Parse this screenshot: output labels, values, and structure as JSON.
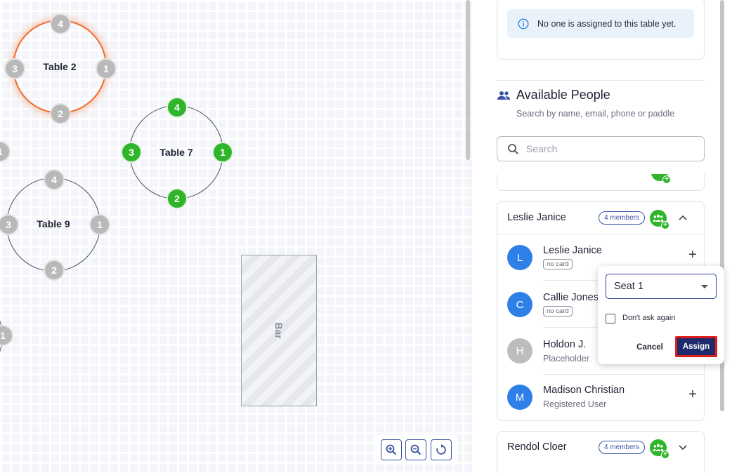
{
  "floor": {
    "tables": [
      {
        "label": "Table 2",
        "seats": [
          "4",
          "1",
          "2",
          "3"
        ],
        "selected": true
      },
      {
        "label": "Table 7",
        "seats": [
          "4",
          "1",
          "2",
          "3"
        ],
        "selected": false
      },
      {
        "label": "Table 9",
        "seats": [
          "4",
          "1",
          "2",
          "3"
        ],
        "selected": false
      }
    ],
    "partial_seat_labels": [
      "1",
      "1"
    ],
    "bar_label": "Bar",
    "zoom_controls": [
      "zoom-in-icon",
      "zoom-out-icon",
      "reset-view-icon"
    ]
  },
  "assigned_info": "No one is assigned to this table yet.",
  "available": {
    "title": "Available People",
    "subtitle": "Search by name, email, phone or paddle",
    "search_placeholder": "Search"
  },
  "group1": {
    "name": "Leslie Janice",
    "badge": "4 members",
    "people": [
      {
        "initial": "L",
        "name": "Leslie Janice",
        "chip": "no card",
        "color": "#2f7fe8"
      },
      {
        "initial": "C",
        "name": "Callie Jones",
        "chip": "no card",
        "color": "#2f7fe8"
      },
      {
        "initial": "H",
        "name": "Holdon J.",
        "sub": "Placeholder",
        "color": "#bdbdbd"
      },
      {
        "initial": "M",
        "name": "Madison Christian",
        "sub": "Registered User",
        "color": "#2f7fe8"
      }
    ]
  },
  "group2": {
    "name": "Rendol Cloer",
    "badge": "4 members"
  },
  "popup": {
    "seat_value": "Seat 1",
    "checkbox_label": "Don't ask again",
    "cancel_label": "Cancel",
    "assign_label": "Assign"
  },
  "colors": {
    "accent": "#1d2a6b",
    "selected_table": "#f26b2c",
    "seat_assigned": "#2fb52a",
    "highlight": "#e01d1d"
  }
}
